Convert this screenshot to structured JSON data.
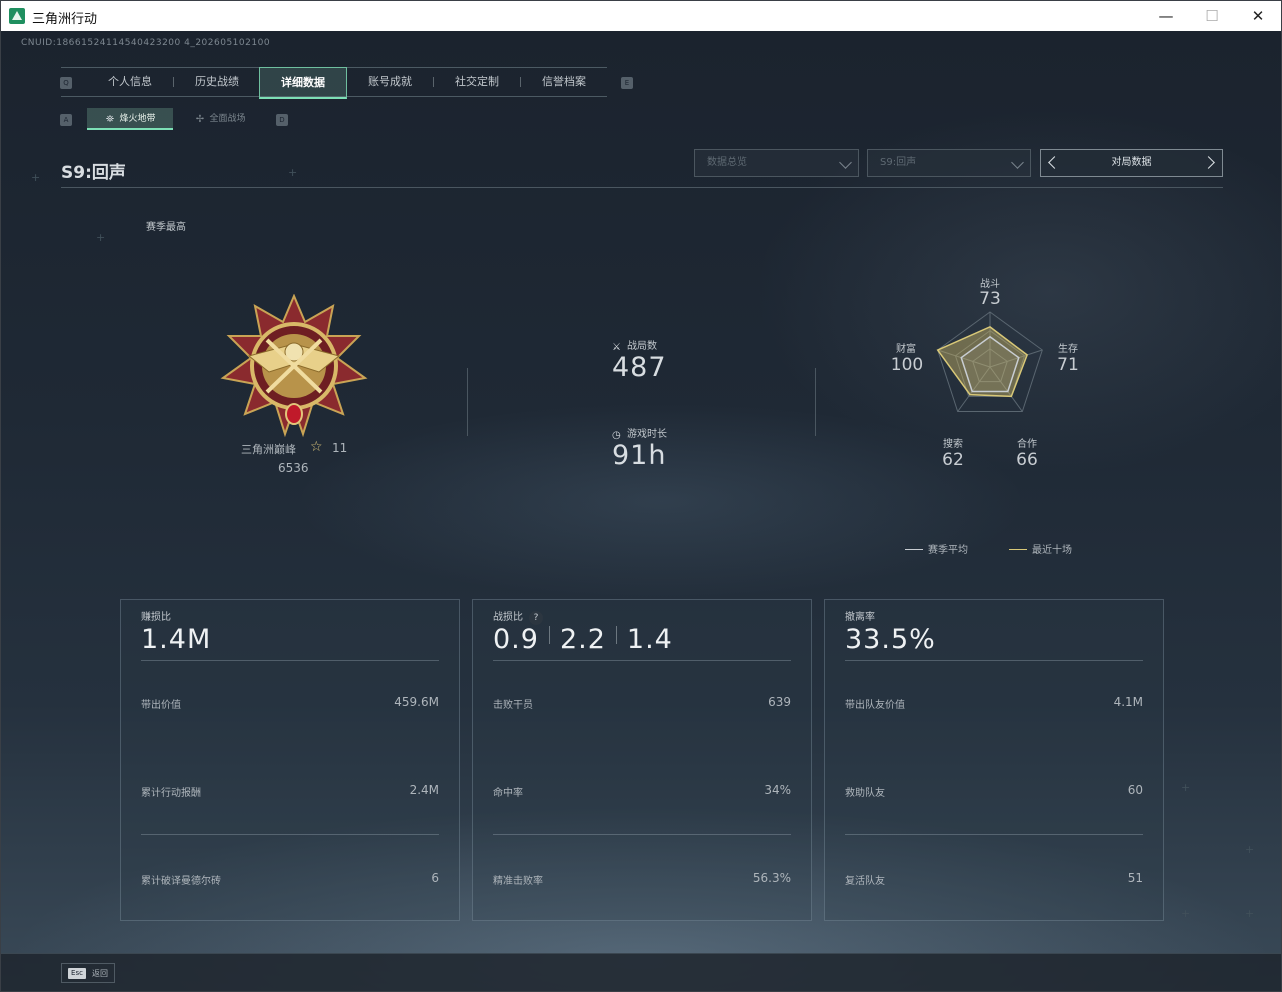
{
  "window": {
    "title": "三角洲行动",
    "minimize": "—",
    "maximize": "☐",
    "close": "✕"
  },
  "cnuid": "CNUID:18661524114540423200 4_202605102100",
  "nav": {
    "key_left": "Q",
    "key_right": "E",
    "tabs": [
      "个人信息",
      "历史战绩",
      "详细数据",
      "账号成就",
      "社交定制",
      "信誉档案"
    ],
    "active_index": 2
  },
  "subnav": {
    "key_left": "A",
    "key_right": "D",
    "tabs": [
      "烽火地带",
      "全面战场"
    ],
    "active_index": 0
  },
  "season_title": "S9:回声",
  "filters": {
    "dropdown1": "数据总览",
    "dropdown2": "S9:回声",
    "pager_label": "对局数据"
  },
  "season_best": {
    "label": "赛季最高",
    "rank_name": "三角洲巅峰",
    "rank_stars": "11",
    "score": "6536"
  },
  "matches": {
    "label": "战局数",
    "value": "487"
  },
  "playtime": {
    "label": "游戏时长",
    "value": "91h"
  },
  "radar": {
    "axes": [
      {
        "label": "战斗",
        "value": "73"
      },
      {
        "label": "生存",
        "value": "71"
      },
      {
        "label": "合作",
        "value": "66"
      },
      {
        "label": "搜索",
        "value": "62"
      },
      {
        "label": "财富",
        "value": "100"
      }
    ],
    "season_avg": [
      0.55,
      0.55,
      0.55,
      0.55,
      0.55
    ],
    "recent10": [
      0.73,
      0.71,
      0.66,
      0.62,
      1.0
    ],
    "colors": {
      "recent": "#d8c878",
      "avg": "#c8cdd2"
    }
  },
  "legend": {
    "season_avg": "赛季平均",
    "recent10": "最近十场"
  },
  "cards": [
    {
      "label": "赚损比",
      "big": "1.4M",
      "rows": [
        {
          "label": "带出价值",
          "value": "459.6M"
        },
        {
          "label": "累计行动报酬",
          "value": "2.4M"
        },
        {
          "label": "累计破译曼德尔砖",
          "value": "6"
        }
      ]
    },
    {
      "label": "战损比",
      "help": "?",
      "big_parts": [
        "0.9",
        "2.2",
        "1.4"
      ],
      "rows": [
        {
          "label": "击败干员",
          "value": "639"
        },
        {
          "label": "命中率",
          "value": "34%"
        },
        {
          "label": "精准击败率",
          "value": "56.3%"
        }
      ]
    },
    {
      "label": "撤离率",
      "big": "33.5%",
      "rows": [
        {
          "label": "带出队友价值",
          "value": "4.1M"
        },
        {
          "label": "救助队友",
          "value": "60"
        },
        {
          "label": "复活队友",
          "value": "51"
        }
      ]
    }
  ],
  "footer": {
    "esc_key": "Esc",
    "esc_label": "返回"
  }
}
